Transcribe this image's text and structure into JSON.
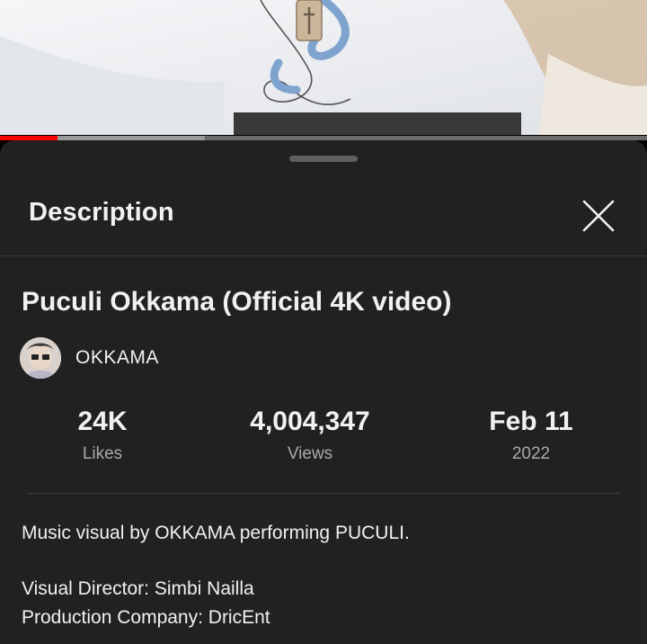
{
  "player": {
    "progress_played": 0.089,
    "progress_buffered": 0.317
  },
  "sheet": {
    "title": "Description",
    "close_icon": "close-icon"
  },
  "video": {
    "title": "Puculi Okkama (Official 4K video)",
    "channel_name": "OKKAMA"
  },
  "stats": [
    {
      "value": "24K",
      "label": "Likes"
    },
    {
      "value": "4,004,347",
      "label": "Views"
    },
    {
      "value": "Feb 11",
      "label": "2022"
    }
  ],
  "description": {
    "lines": [
      "Music visual by OKKAMA performing PUCULI.",
      "Visual Director: Simbi Nailla",
      "Production Company: DricEnt"
    ]
  },
  "colors": {
    "sheet_bg": "#212121",
    "progress_red": "#ff0000",
    "secondary_text": "#aaaaaa"
  }
}
